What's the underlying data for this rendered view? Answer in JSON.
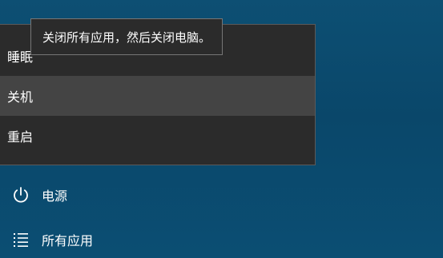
{
  "tooltip": {
    "text": "关闭所有应用，然后关闭电脑。"
  },
  "power_menu": {
    "items": [
      {
        "label": "睡眠",
        "icon": "none"
      },
      {
        "label": "关机",
        "icon": "none"
      },
      {
        "label": "重启",
        "icon": "none"
      }
    ]
  },
  "start": {
    "power_label": "电源",
    "power_icon": "power-icon",
    "all_apps_label": "所有应用",
    "all_apps_icon": "list-icon"
  },
  "colors": {
    "desktop": "#0b4a6b",
    "menu_bg": "#2b2b2b",
    "menu_hover": "#444444",
    "tooltip_border": "#767676"
  }
}
